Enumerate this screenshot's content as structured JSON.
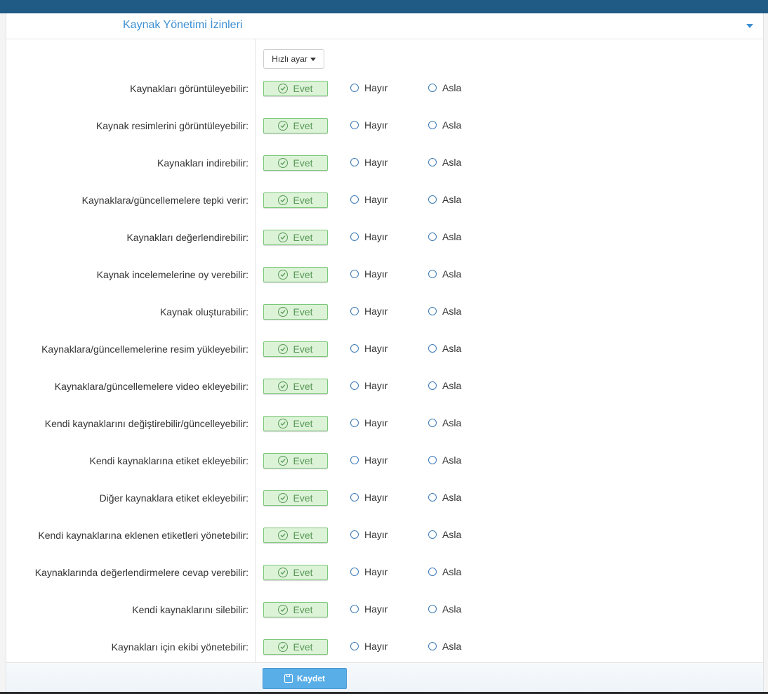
{
  "section": {
    "title": "Kaynak Yönetimi İzinleri"
  },
  "quick_settings": {
    "label": "Hızlı ayar"
  },
  "options": {
    "yes": "Evet",
    "no": "Hayır",
    "never": "Asla"
  },
  "permissions": [
    {
      "label": "Kaynakları görüntüleyebilir:",
      "selected": "Evet"
    },
    {
      "label": "Kaynak resimlerini görüntüleyebilir:",
      "selected": "Evet"
    },
    {
      "label": "Kaynakları indirebilir:",
      "selected": "Evet"
    },
    {
      "label": "Kaynaklara/güncellemelere tepki verir:",
      "selected": "Evet"
    },
    {
      "label": "Kaynakları değerlendirebilir:",
      "selected": "Evet"
    },
    {
      "label": "Kaynak incelemelerine oy verebilir:",
      "selected": "Evet"
    },
    {
      "label": "Kaynak oluşturabilir:",
      "selected": "Evet"
    },
    {
      "label": "Kaynaklara/güncellemelerine resim yükleyebilir:",
      "selected": "Evet"
    },
    {
      "label": "Kaynaklara/güncellemelere video ekleyebilir:",
      "selected": "Evet"
    },
    {
      "label": "Kendi kaynaklarını değiştirebilir/güncelleyebilir:",
      "selected": "Evet"
    },
    {
      "label": "Kendi kaynaklarına etiket ekleyebilir:",
      "selected": "Evet"
    },
    {
      "label": "Diğer kaynaklara etiket ekleyebilir:",
      "selected": "Evet"
    },
    {
      "label": "Kendi kaynaklarına eklenen etiketleri yönetebilir:",
      "selected": "Evet"
    },
    {
      "label": "Kaynaklarında değerlendirmelere cevap verebilir:",
      "selected": "Evet"
    },
    {
      "label": "Kendi kaynaklarını silebilir:",
      "selected": "Evet"
    },
    {
      "label": "Kaynakları için ekibi yönetebilir:",
      "selected": "Evet"
    }
  ],
  "footer": {
    "save_label": "Kaydet"
  },
  "colors": {
    "topbar": "#1f5b85",
    "accent": "#3d8fd1",
    "selected_bg": "#dcf3d8",
    "selected_text": "#5b9a59",
    "save_button": "#5aaee8"
  },
  "icons": {
    "collapse": "caret-down-icon",
    "selected": "check-circle-icon",
    "save": "floppy-disk-icon"
  }
}
